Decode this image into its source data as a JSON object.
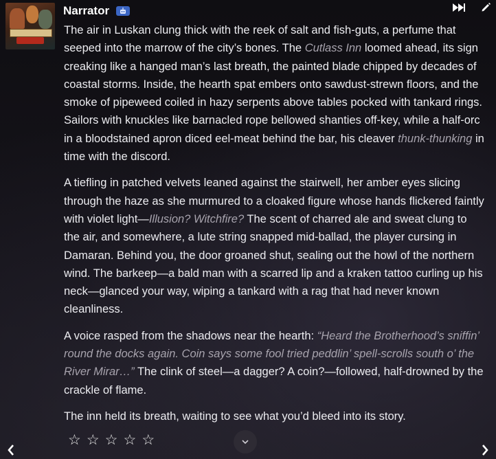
{
  "narrator": {
    "name": "Narrator",
    "badge_icon": "robot-icon"
  },
  "toolbar": {
    "fast_forward_icon": "fast-forward-icon",
    "edit_icon": "pencil-icon"
  },
  "message": {
    "p1": {
      "t1": "The air in Luskan clung thick with the reek of salt and fish-guts, a perfume that seeped into the marrow of the city’s bones. The ",
      "e1": "Cutlass Inn",
      "t2": " loomed ahead, its sign creaking like a hanged man’s last breath, the painted blade chipped by decades of coastal storms. Inside, the hearth spat embers onto sawdust-strewn floors, and the smoke of pipeweed coiled in hazy serpents above tables pocked with tankard rings. Sailors with knuckles like barnacled rope bellowed shanties off-key, while a half-orc in a bloodstained apron diced eel-meat behind the bar, his cleaver ",
      "e2": "thunk-thunking",
      "t3": " in time with the discord."
    },
    "p2": {
      "t1": "A tiefling in patched velvets leaned against the stairwell, her amber eyes slicing through the haze as she murmured to a cloaked figure whose hands flickered faintly with violet light—",
      "e1": "Illusion? Witchfire?",
      "t2": " The scent of charred ale and sweat clung to the air, and somewhere, a lute string snapped mid-ballad, the player cursing in Damaran. Behind you, the door groaned shut, sealing out the howl of the northern wind. The barkeep—a bald man with a scarred lip and a kraken tattoo curling up his neck—glanced your way, wiping a tankard with a rag that had never known cleanliness."
    },
    "p3": {
      "t1": "A voice rasped from the shadows near the hearth: ",
      "e1": "“Heard the Brotherhood’s sniffin’ round the docks again. Coin says some fool tried peddlin’ spell-scrolls south o’ the River Mirar…”",
      "t2": " The clink of steel—a dagger? A coin?—followed, half-drowned by the crackle of flame."
    },
    "p4": "The inn held its breath, waiting to see what you’d bleed into its story."
  },
  "rating": {
    "stars": [
      "☆",
      "☆",
      "☆",
      "☆",
      "☆"
    ],
    "value": 0,
    "max": 5
  },
  "controls": {
    "expand_icon": "chevron-down-icon",
    "prev_icon": "chevron-left-icon",
    "next_icon": "chevron-right-icon"
  }
}
